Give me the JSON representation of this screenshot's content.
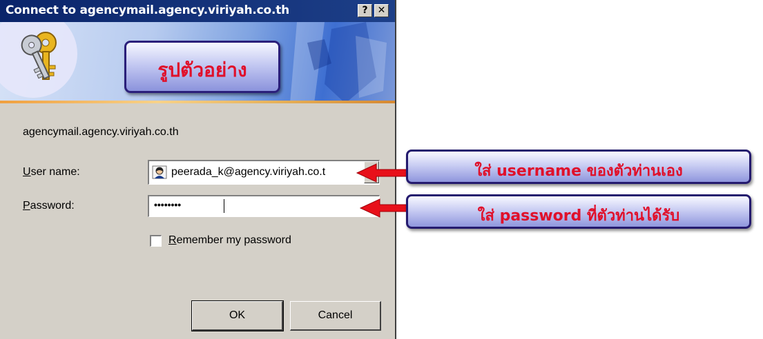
{
  "dialog": {
    "title": "Connect to agencymail.agency.viriyah.co.th",
    "help_button": "?",
    "close_button": "✕",
    "banner_label": "รูปตัวอย่าง",
    "server": "agencymail.agency.viriyah.co.th",
    "username_label_key": "U",
    "username_label_rest": "ser name:",
    "password_label_key": "P",
    "password_label_rest": "assword:",
    "username_value": "peerada_k@agency.viriyah.co.t",
    "password_value": "••••••••",
    "remember_key": "R",
    "remember_rest": "emember my password",
    "remember_checked": false,
    "ok_label": "OK",
    "cancel_label": "Cancel"
  },
  "annotations": {
    "username_hint": "ใส่ username ของตัวท่านเอง",
    "password_hint": "ใส่ password ที่ตัวท่านได้รับ"
  },
  "colors": {
    "title_bar": "#0a246a",
    "annotation_text": "#e0102a",
    "arrow": "#e8101a",
    "dialog_face": "#d4d0c8"
  },
  "icons": [
    "keys-icon",
    "user-icon",
    "dropdown-arrow-icon",
    "arrow-left-icon"
  ]
}
